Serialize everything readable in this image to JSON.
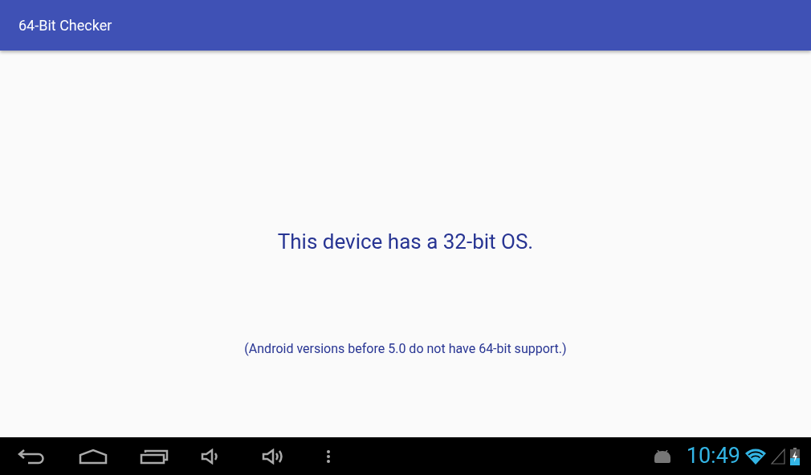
{
  "app_bar": {
    "title": "64-Bit Checker"
  },
  "content": {
    "message": "This device has a 32-bit OS.",
    "note": "(Android versions before 5.0 do not have 64-bit support.)"
  },
  "status_bar": {
    "time": "10:49"
  }
}
